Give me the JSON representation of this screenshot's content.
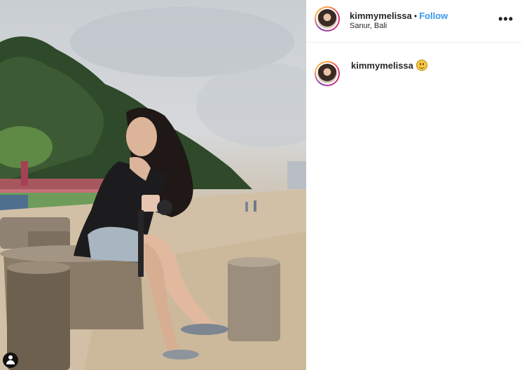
{
  "post": {
    "username": "kimmymelissa",
    "separator": "•",
    "follow_label": "Follow",
    "location": "Sanur, Bali",
    "more_label": "•••"
  },
  "caption": {
    "username": "kimmymelissa",
    "emoji": "slightly-smiling-face-icon"
  },
  "icons": {
    "more": "more-options-icon",
    "tag": "user-tag-icon"
  },
  "colors": {
    "follow": "#3897f0",
    "text": "#262626",
    "divider": "#efefef"
  }
}
